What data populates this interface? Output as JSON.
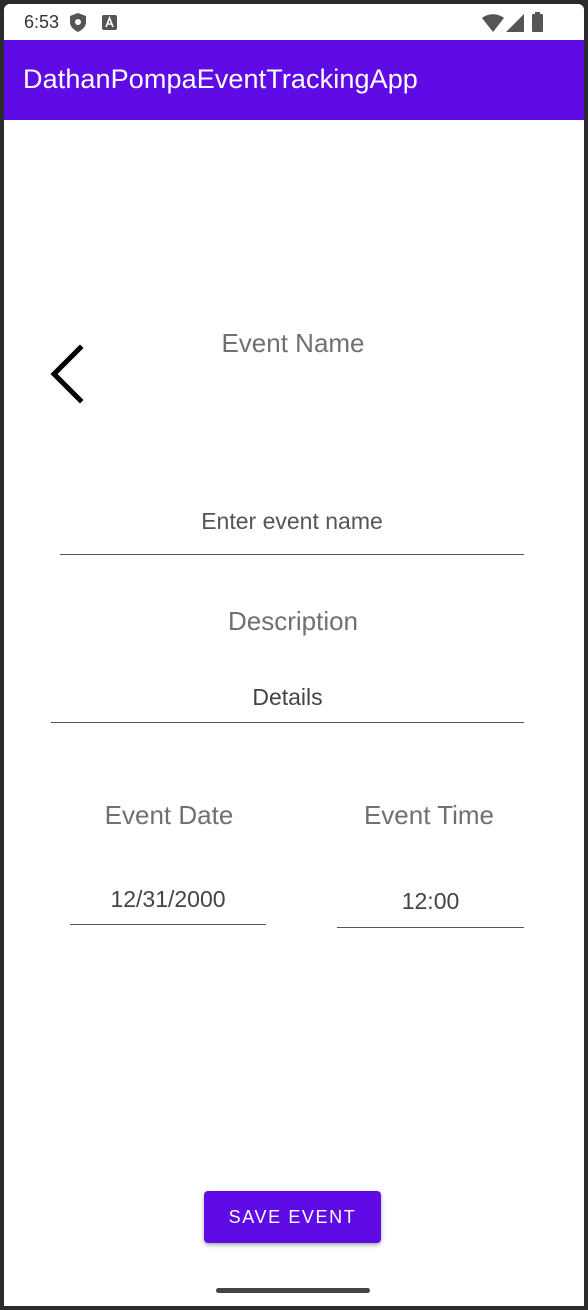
{
  "status_bar": {
    "time": "6:53"
  },
  "app_bar": {
    "title": "DathanPompaEventTrackingApp",
    "color": "#5f0be6"
  },
  "form": {
    "event_name_label": "Event Name",
    "event_name_placeholder": "Enter event name",
    "description_label": "Description",
    "description_value": "Details",
    "event_date_label": "Event Date",
    "event_date_value": "12/31/2000",
    "event_time_label": "Event Time",
    "event_time_value": "12:00"
  },
  "actions": {
    "save_label": "SAVE EVENT"
  },
  "icons": {
    "back": "chevron-left-icon",
    "shield": "shield-icon",
    "app_notification": "a-box-icon",
    "wifi": "wifi-icon",
    "signal": "signal-icon",
    "battery": "battery-icon"
  }
}
